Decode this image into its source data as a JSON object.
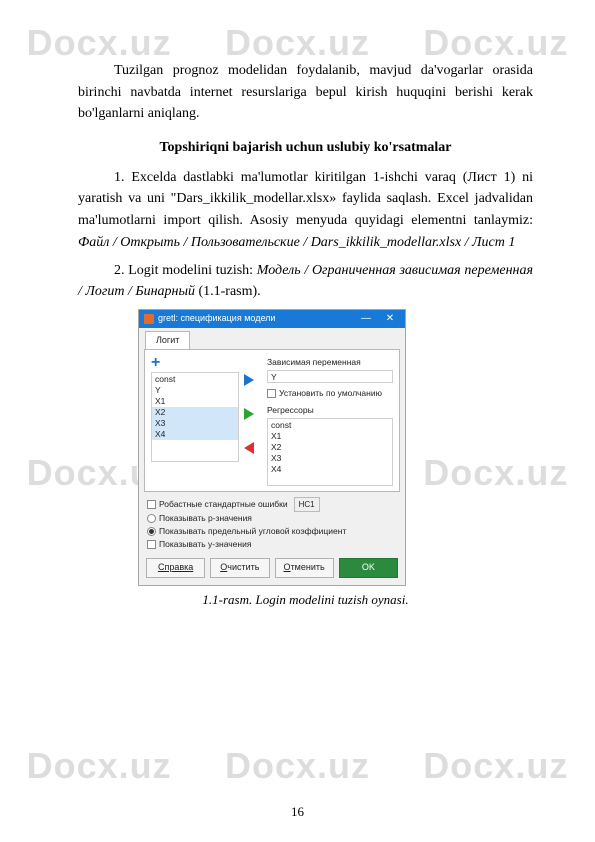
{
  "watermark": "Docx.uz",
  "paragraphs": {
    "p1": "Tuzilgan prognoz modelidan foydalanib, mavjud da'vogarlar orasida birinchi navbatda internet resurslariga bepul kirish huquqini berishi kerak bo'lganlarni aniqlang.",
    "heading": "Topshiriqni bajarish uchun uslubiy ko'rsatmalar",
    "p2a": "1. Excelda dastlabki ma'lumotlar kiritilgan 1-ishchi varaq (Лист 1) ni yaratish va uni \"Dars_ikkilik_modellar.xlsx» faylida saqlash. Excel jadvalidan ma'lumotlarni import qilish. Asosiy menyuda quyidagi elementni tanlaymiz: ",
    "p2b": "Файл / Открыть / Пользовательские / Dars_ikkilik_modellar.xlsx / Лист 1",
    "p3a": "2. Logit modelini tuzish: ",
    "p3b": "Модель / Ограниченная зависимая переменная / Логит / Бинарный",
    "p3c": " (1.1-rasm).",
    "caption": "1.1-rasm. Login modelini tuzish oynasi."
  },
  "dialog": {
    "title": "gretl: спецификация модели",
    "tab": "Логит",
    "left_vars": [
      "const",
      "Y",
      "X1",
      "X2",
      "X3",
      "X4"
    ],
    "dep_label": "Зависимая переменная",
    "dep_value": "Y",
    "default_chk": "Установить по умолчанию",
    "reg_label": "Регрессоры",
    "reg_vars": [
      "const",
      "X1",
      "X2",
      "X3",
      "X4"
    ],
    "opt_robust": "Робастные стандартные ошибки",
    "hc_label": "HC1",
    "opt_pvalues": "Показывать p-значения",
    "opt_slope": "Показывать предельный угловой коэффициент",
    "opt_values": "Показывать у-значения",
    "btn_help": "Справка",
    "btn_clear": "Очистить",
    "btn_cancel": "Отменить",
    "btn_ok": "OK"
  },
  "page_number": "16"
}
